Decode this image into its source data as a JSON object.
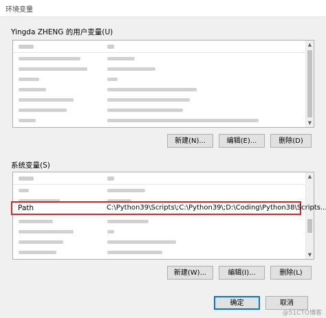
{
  "window": {
    "title": "环境变量"
  },
  "user_vars": {
    "label": "Yingda ZHENG 的用户变量(U)"
  },
  "system_vars": {
    "label": "系统变量(S)"
  },
  "path_row": {
    "name": "Path",
    "value": "C:\\Python39\\Scripts\\;C:\\Python39\\;D:\\Coding\\Python38\\Scripts..."
  },
  "user_buttons": {
    "new": "新建(N)...",
    "edit": "编辑(E)...",
    "delete": "删除(D)"
  },
  "system_buttons": {
    "new": "新建(W)...",
    "edit": "编辑(I)...",
    "delete": "删除(L)"
  },
  "footer": {
    "ok": "确定",
    "cancel": "取消"
  },
  "watermark": "@51CTO博客",
  "colors": {
    "highlight": "#d9232a",
    "default_button_border": "#0078d7"
  }
}
